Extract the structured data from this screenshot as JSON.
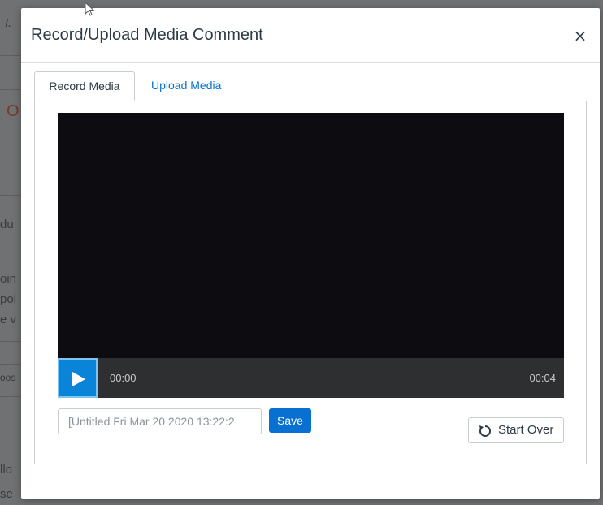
{
  "background": {
    "fragments": [
      "I.",
      "O",
      "du",
      "oin",
      "poi",
      "e v",
      "oos",
      "llo",
      "se"
    ]
  },
  "modal": {
    "title": "Record/Upload Media Comment",
    "close_label": "×",
    "tabs": [
      {
        "label": "Record Media",
        "active": true
      },
      {
        "label": "Upload Media",
        "active": false
      }
    ],
    "player": {
      "current_time": "00:00",
      "duration": "00:04"
    },
    "title_input": {
      "value": "[Untitled Fri Mar 20 2020 13:22:2"
    },
    "save_label": "Save",
    "start_over_label": "Start Over"
  }
}
